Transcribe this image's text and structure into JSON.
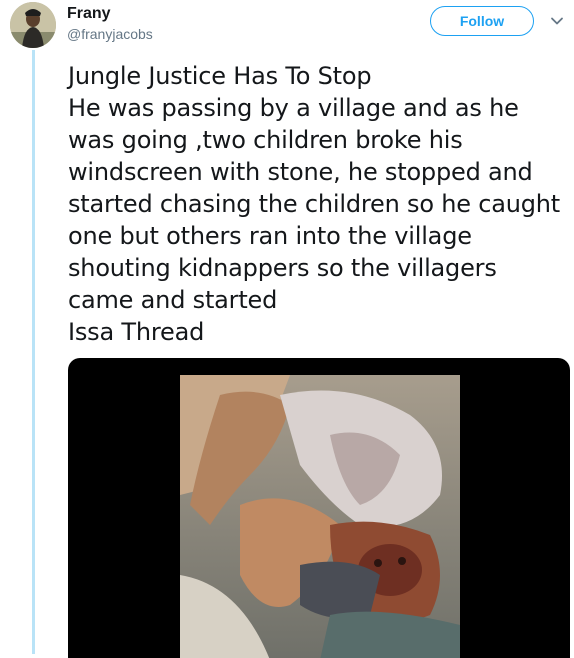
{
  "author": {
    "display_name": "Frany",
    "handle": "@franyjacobs"
  },
  "actions": {
    "follow_label": "Follow",
    "menu_icon": "chevron-down-icon"
  },
  "tweet": {
    "lines": [
      "Jungle Justice Has To Stop",
      "He was passing by a village and as he",
      "was going ,two children broke his",
      "windscreen with stone, he stopped and",
      "started chasing the children so he caught",
      "one but others ran into the village",
      "shouting kidnappers so the villagers",
      "came and started",
      "Issa Thread"
    ]
  },
  "colors": {
    "accent": "#1da1f2",
    "text": "#14171a",
    "secondary_text": "#657786",
    "thread_line": "#b9e3f7"
  }
}
